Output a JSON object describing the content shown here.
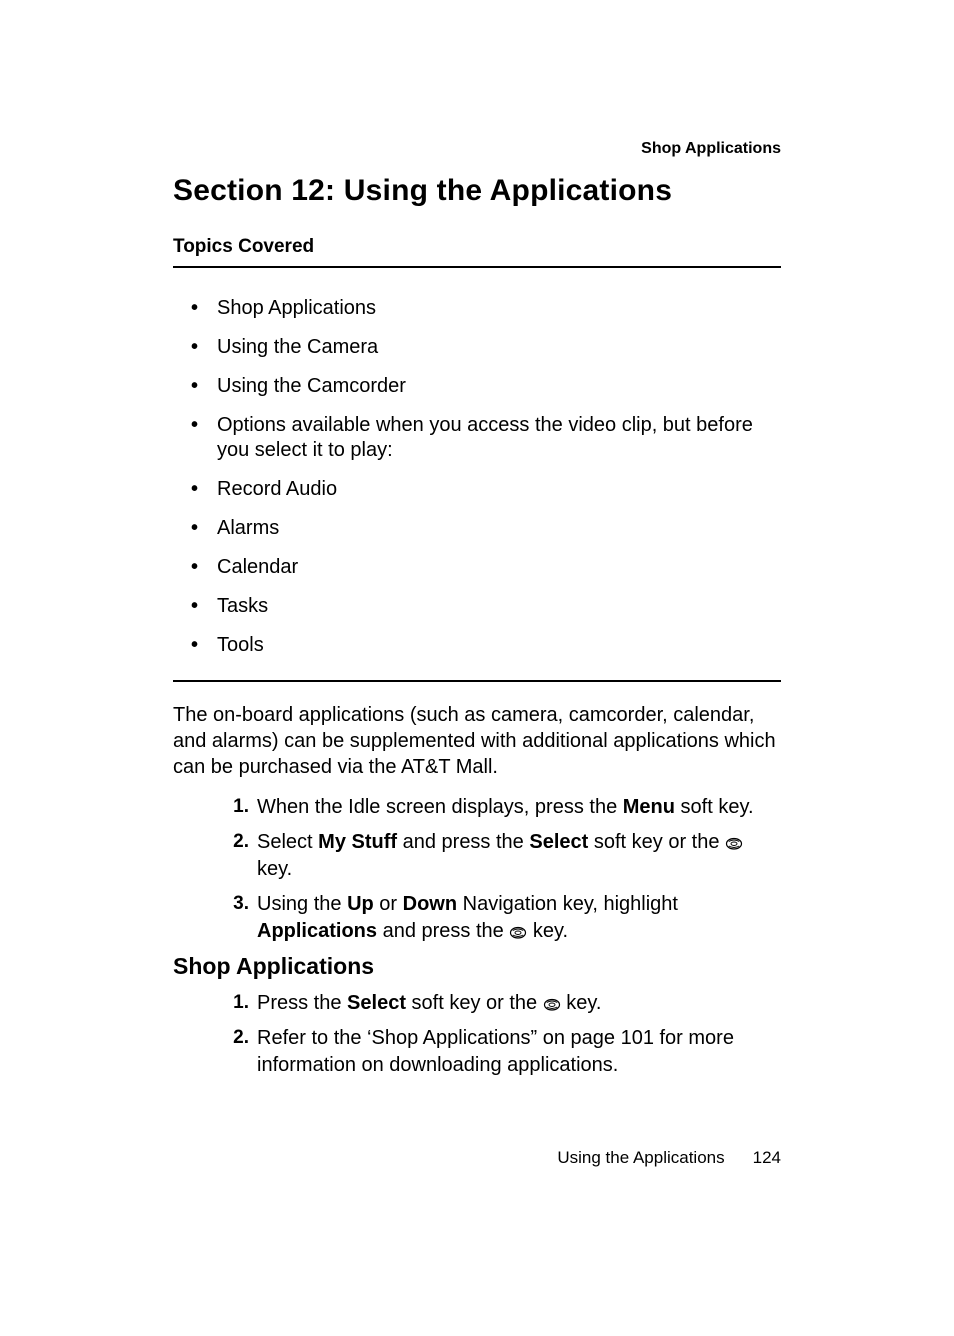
{
  "header": {
    "topic_label": "Shop Applications"
  },
  "title": "Section 12: Using the Applications",
  "topics_heading": "Topics Covered",
  "topics": [
    "Shop Applications",
    "Using the Camera",
    "Using the Camcorder",
    "Options available when you access the video clip, but before you select it to play:",
    "Record Audio",
    "Alarms",
    "Calendar",
    "Tasks",
    "Tools"
  ],
  "intro_paragraph": "The on-board applications (such as camera, camcorder, calendar, and alarms) can be supplemented with additional applications which can be purchased via the AT&T Mall.",
  "steps_main": [
    {
      "prefix": "When the Idle screen displays, press the ",
      "bold1": "Menu",
      "suffix1": " soft key."
    },
    {
      "prefix": "Select ",
      "bold1": "My Stuff",
      "mid1": " and press the ",
      "bold2": "Select",
      "mid2": " soft key or the ",
      "icon": "nav-key-icon",
      "suffix1": " key."
    },
    {
      "prefix": "Using the ",
      "bold1": "Up",
      "mid1": " or ",
      "bold2": "Down",
      "mid2": " Navigation key, highlight ",
      "bold3": "Applications",
      "mid3": " and press the ",
      "icon": "nav-key-icon",
      "suffix1": " key."
    }
  ],
  "sub_heading": "Shop Applications",
  "steps_sub": [
    {
      "prefix": "Press the ",
      "bold1": "Select",
      "mid1": " soft key or the ",
      "icon": "nav-key-icon",
      "suffix1": " key."
    },
    {
      "text": "Refer to the ‘Shop Applications” on page 101 for more information on downloading applications."
    }
  ],
  "footer": {
    "chapter": "Using the Applications",
    "page": "124"
  },
  "icons": {
    "nav-key-icon": "circular navigation / OK key glyph"
  }
}
